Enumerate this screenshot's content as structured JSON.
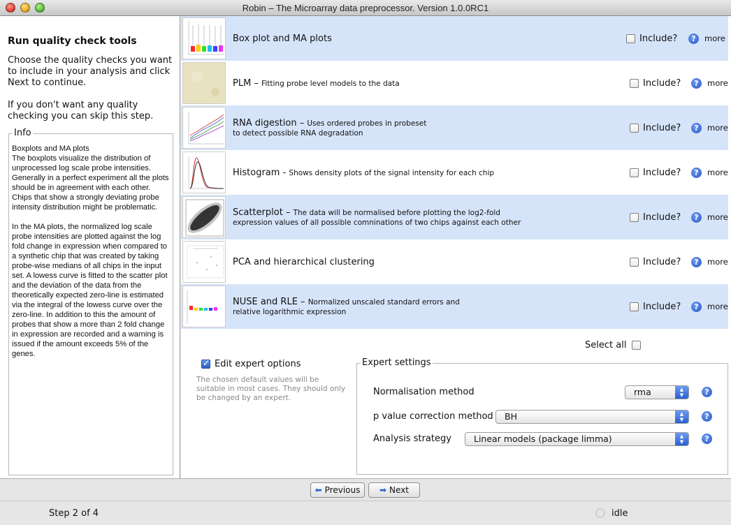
{
  "window": {
    "title": "Robin – The Microarray data preprocessor. Version 1.0.0RC1"
  },
  "left": {
    "heading": "Run quality check tools",
    "intro": "Choose the quality checks you want to include in your analysis and click Next to continue.",
    "skip": "If you don't want any quality checking you can skip this step.",
    "info_legend": "Info",
    "info_title": "Boxplots and MA plots",
    "info_p1": "The boxplots visualize the distribution of unprocessed log scale probe intensities. Generally in a perfect experiment all the plots should be in agreement with each other. Chips that show a strongly deviating probe intensity distribution might be problematic.",
    "info_p2": "In the MA plots, the normalized log scale probe intensities are plotted against the log fold change in expression when compared to a synthetic chip that was created by taking probe-wise medians of all chips in the input set. A lowess curve is fitted to the scatter plot and the deviation of the data from the theoretically expected zero-line is estimated via the integral of the lowess curve over the zero-line. In addition to this the amount of probes that show a more than 2 fold change in expression are recorded and a warning is issued if the amount exceeds 5% of the genes."
  },
  "checks": {
    "include_label": "Include?",
    "more_label": "more",
    "items": [
      {
        "title": "Box plot and MA plots",
        "desc": "",
        "desc2": ""
      },
      {
        "title": "PLM",
        "desc": "Fitting probe level models to the data",
        "desc2": ""
      },
      {
        "title": "RNA digestion",
        "desc": "Uses ordered probes in probeset",
        "desc2": "to detect possible RNA degradation"
      },
      {
        "title": "Histogram",
        "desc": "Shows density plots of the signal intensity for each chip",
        "desc2": ""
      },
      {
        "title": "Scatterplot",
        "desc": "The data will be normalised before plotting the log2-fold",
        "desc2": "expression values of all possible comninations of two chips against each other"
      },
      {
        "title": "PCA and hierarchical clustering",
        "desc": "",
        "desc2": ""
      },
      {
        "title": "NUSE and RLE",
        "desc": "Normalized unscaled standard errors and",
        "desc2": "relative logarithmic expression"
      }
    ]
  },
  "select_all": "Select all",
  "expert": {
    "edit_label": "Edit expert options",
    "edit_checked": true,
    "note": "The chosen default values will be suitable in most cases. They should only be changed by an expert.",
    "legend": "Expert settings",
    "normalisation_label": "Normalisation method",
    "normalisation_value": "rma",
    "pvalue_label": "p value correction method",
    "pvalue_value": "BH",
    "strategy_label": "Analysis strategy",
    "strategy_value": "Linear models (package limma)"
  },
  "buttons": {
    "previous": "Previous",
    "next": "Next"
  },
  "status": {
    "step": "Step 2 of 4",
    "state": "idle"
  },
  "colors": {
    "row_highlight": "#d6e4fa",
    "accent": "#2a62d0"
  }
}
